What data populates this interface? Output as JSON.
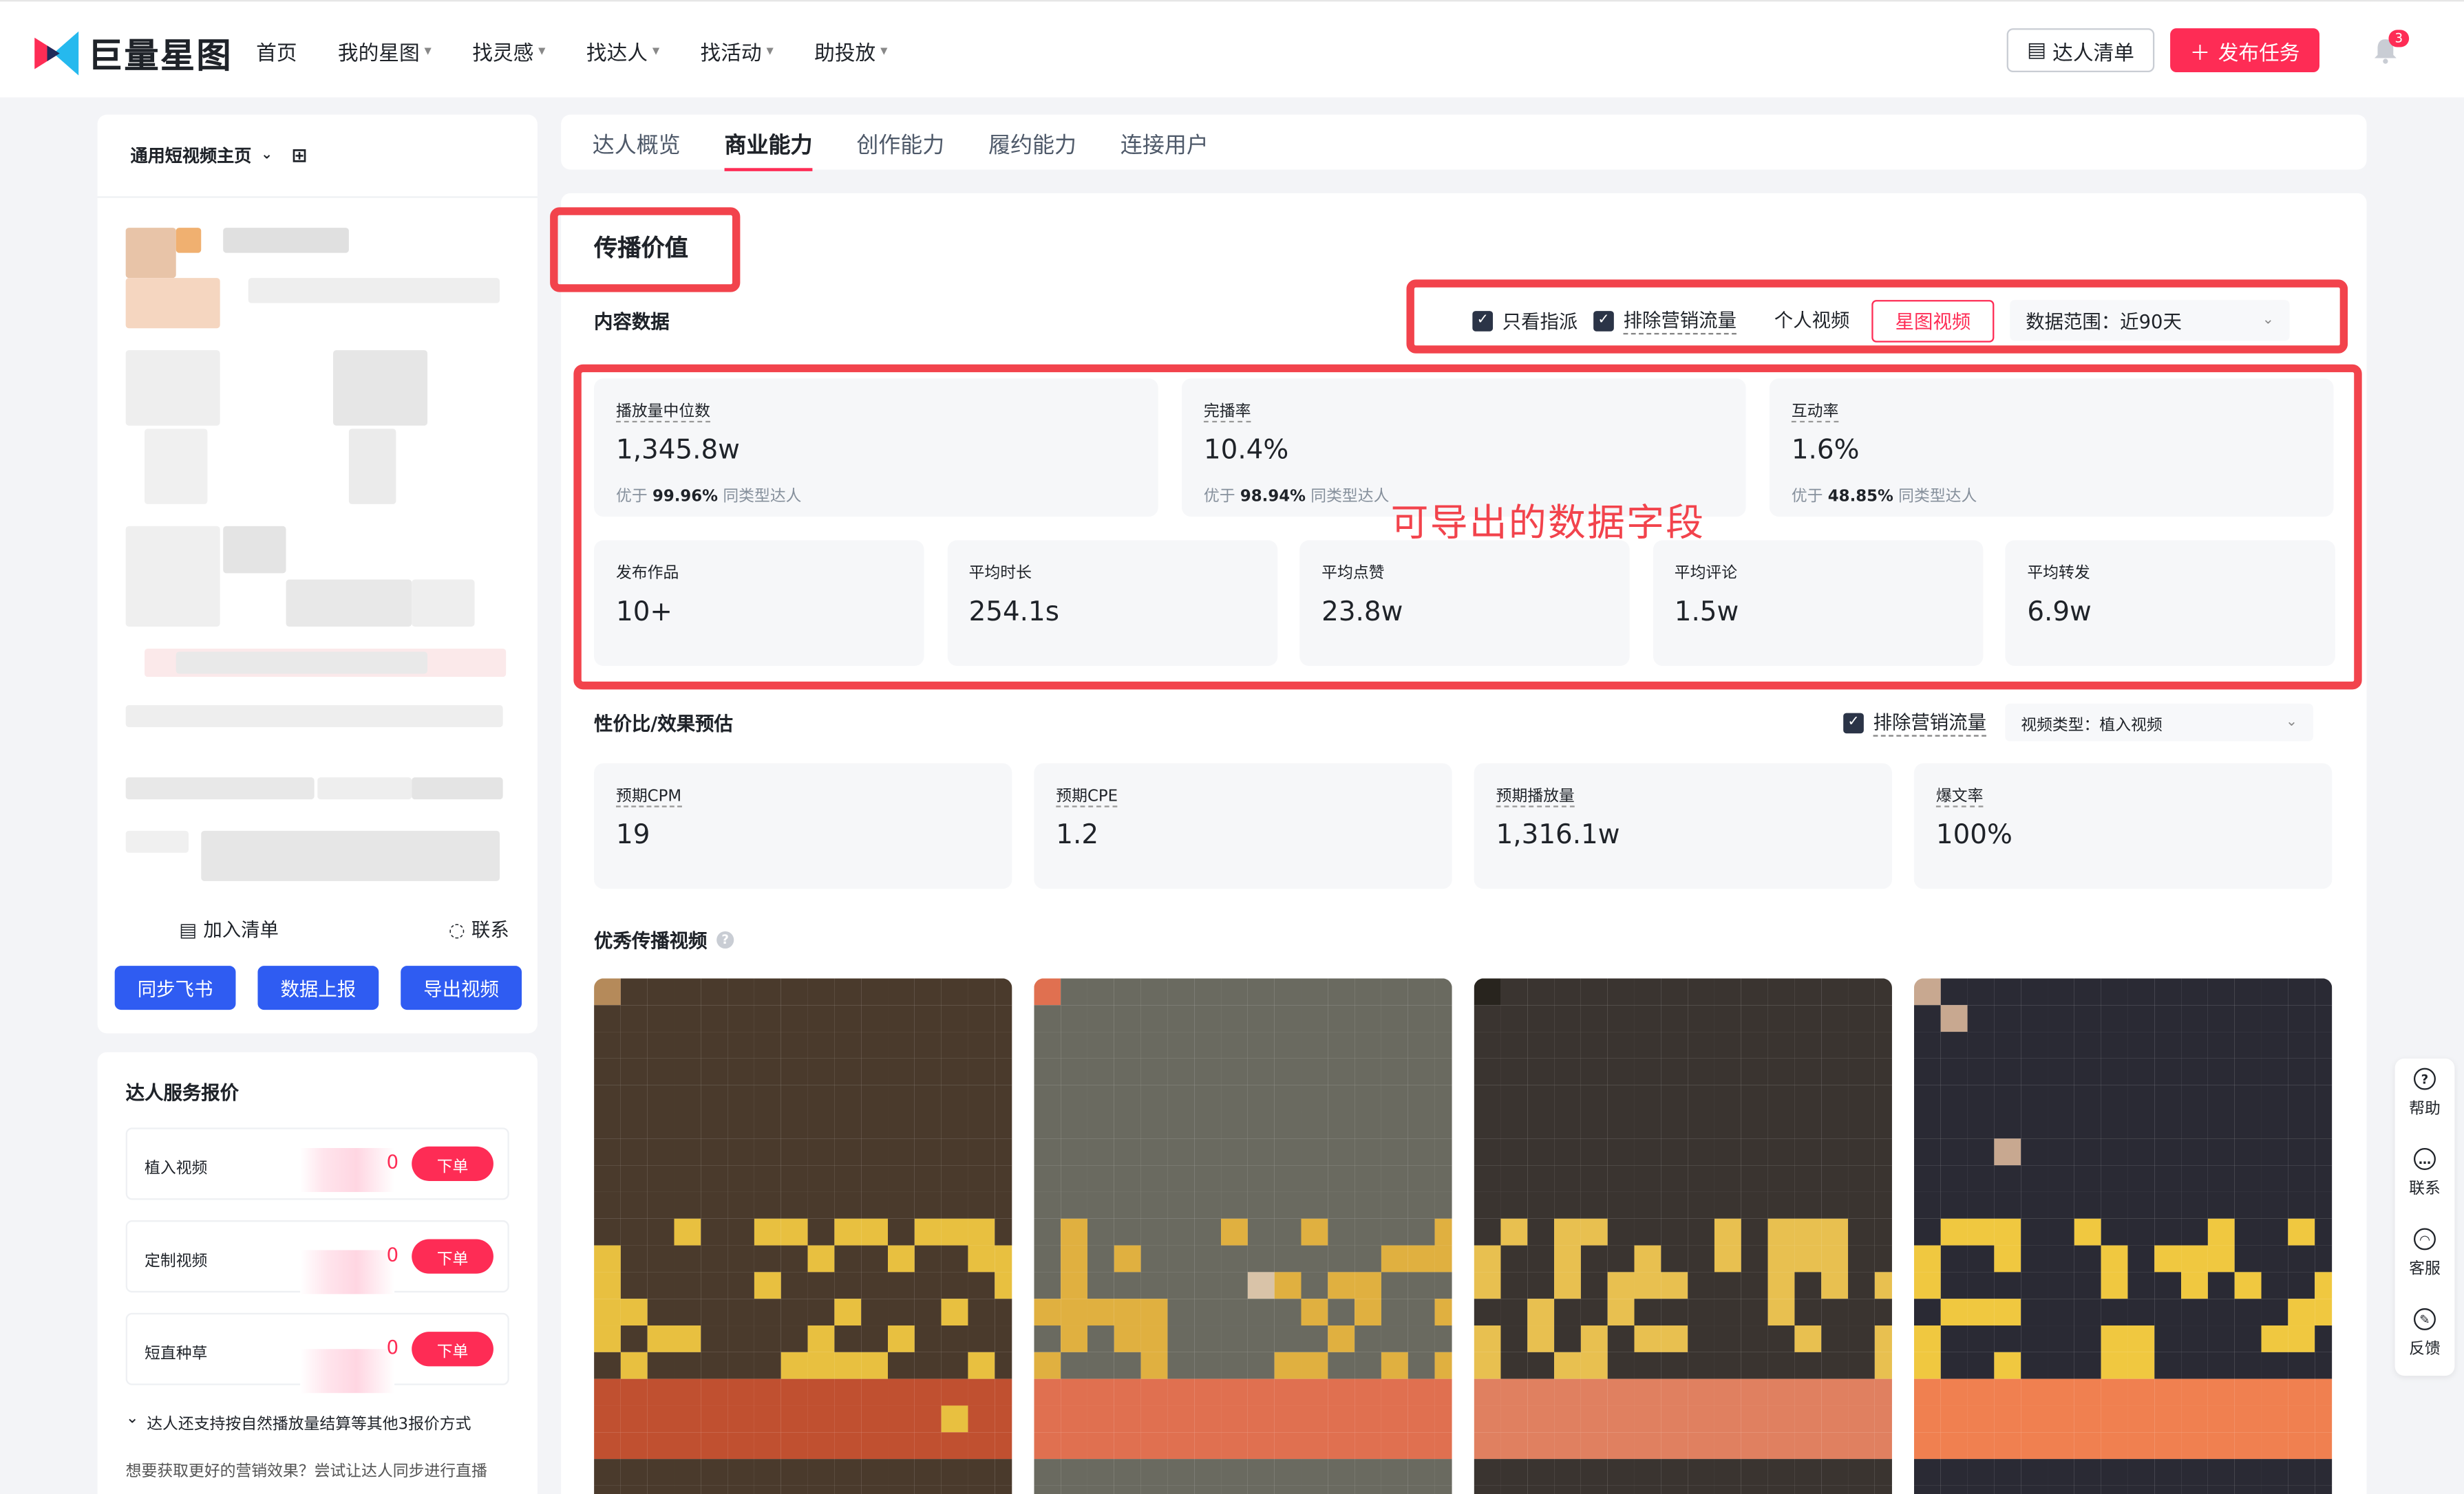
{
  "brand": {
    "name": "巨量星图",
    "accent": "#fe2c55",
    "blue": "#2f5cf2"
  },
  "nav": {
    "items": [
      {
        "label": "首页",
        "caret": false
      },
      {
        "label": "我的星图",
        "caret": true
      },
      {
        "label": "找灵感",
        "caret": true
      },
      {
        "label": "找达人",
        "caret": true
      },
      {
        "label": "找活动",
        "caret": true
      },
      {
        "label": "助投放",
        "caret": true
      }
    ],
    "list_button": "达人清单",
    "publish_button": "发布任务",
    "notification_count": "3"
  },
  "left": {
    "home_select": "通用短视频主页",
    "add_to_list": "加入清单",
    "contact": "联系",
    "buttons": [
      "同步飞书",
      "数据上报",
      "导出视频"
    ]
  },
  "price": {
    "title": "达人服务报价",
    "rows": [
      {
        "name": "植入视频",
        "suffix": "0",
        "action": "下单"
      },
      {
        "name": "定制视频",
        "suffix": "0",
        "action": "下单"
      },
      {
        "name": "短直种草",
        "suffix": "0",
        "action": "下单"
      }
    ],
    "more_note": "达人还支持按自然播放量结算等其他3报价方式",
    "hint": "想要获取更好的营销效果？尝试让达人同步进行直播"
  },
  "tabs": [
    {
      "label": "达人概览",
      "active": false
    },
    {
      "label": "商业能力",
      "active": true
    },
    {
      "label": "创作能力",
      "active": false
    },
    {
      "label": "履约能力",
      "active": false
    },
    {
      "label": "连接用户",
      "active": false
    }
  ],
  "section": {
    "title": "传播价值",
    "content_label": "内容数据",
    "filters": {
      "only_assigned": "只看指派",
      "exclude_marketing": "排除营销流量",
      "segments": [
        {
          "label": "个人视频",
          "active": false
        },
        {
          "label": "星图视频",
          "active": true
        }
      ],
      "range": "数据范围：近90天"
    },
    "stats_top": [
      {
        "label": "播放量中位数",
        "value": "1,345.8w",
        "prefix": "优于",
        "pct": "99.96%",
        "suffix": "同类型达人"
      },
      {
        "label": "完播率",
        "value": "10.4%",
        "prefix": "优于",
        "pct": "98.94%",
        "suffix": "同类型达人"
      },
      {
        "label": "互动率",
        "value": "1.6%",
        "prefix": "优于",
        "pct": "48.85%",
        "suffix": "同类型达人"
      }
    ],
    "stats_bottom": [
      {
        "label": "发布作品",
        "value": "10+"
      },
      {
        "label": "平均时长",
        "value": "254.1s"
      },
      {
        "label": "平均点赞",
        "value": "23.8w"
      },
      {
        "label": "平均评论",
        "value": "1.5w"
      },
      {
        "label": "平均转发",
        "value": "6.9w"
      }
    ],
    "annotation": "可导出的数据字段",
    "estimate": {
      "title": "性价比/效果预估",
      "exclude_marketing": "排除营销流量",
      "video_type": "视频类型：植入视频",
      "stats": [
        {
          "label": "预期CPM",
          "value": "19"
        },
        {
          "label": "预期CPE",
          "value": "1.2"
        },
        {
          "label": "预期播放量",
          "value": "1,316.1w"
        },
        {
          "label": "爆文率",
          "value": "100%"
        }
      ]
    },
    "videos_title": "优秀传播视频"
  },
  "float_menu": [
    "帮助",
    "联系",
    "客服",
    "反馈"
  ],
  "annotation_color": "#f2434c"
}
